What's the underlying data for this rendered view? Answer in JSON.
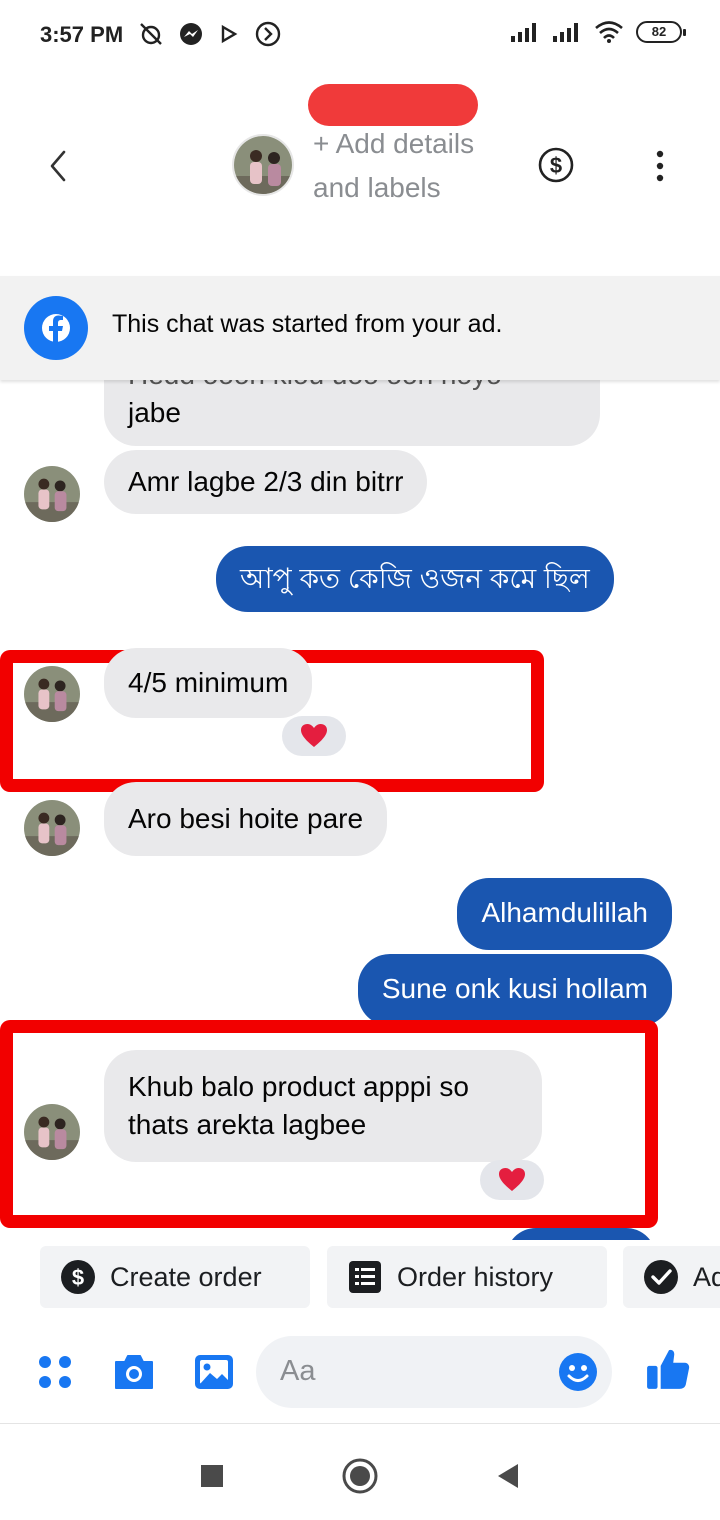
{
  "status_bar": {
    "time": "3:57 PM",
    "battery": "82"
  },
  "header": {
    "add_details": "+ Add details and labels"
  },
  "banner": {
    "text": "This chat was started from your ad."
  },
  "messages": [
    {
      "side": "in",
      "text_top": "Hedd oooh klou uoo ooh hoyo",
      "text": "jabe"
    },
    {
      "side": "in",
      "text": "Amr lagbe 2/3 din bitrr"
    },
    {
      "side": "out",
      "text": "আপু কত কেজি ওজন কমে ছিল"
    },
    {
      "side": "in",
      "text": "4/5 minimum",
      "reaction": "heart"
    },
    {
      "side": "in",
      "text": "Aro besi hoite pare"
    },
    {
      "side": "out",
      "text": "Alhamdulillah"
    },
    {
      "side": "out",
      "text": "Sune onk kusi hollam"
    },
    {
      "side": "in",
      "text_line1": "Khub balo product apppi so",
      "text_line2": "thats arekta lagbee",
      "reaction": "heart"
    }
  ],
  "quick_actions": {
    "create_order": "Create order",
    "order_history": "Order history",
    "third": "Ad"
  },
  "composer": {
    "placeholder": "Aa"
  },
  "colors": {
    "accent": "#1877f2",
    "outgoing_bubble": "#1a56b0",
    "incoming_bubble": "#e9e9eb",
    "highlight": "#f20000",
    "reaction_heart": "#e41e3f"
  },
  "icons": [
    "back-arrow-icon",
    "dollar-icon",
    "more-vertical-icon",
    "facebook-icon",
    "menu-dots-icon",
    "camera-icon",
    "gallery-icon",
    "emoji-icon",
    "thumbs-up-icon",
    "heart-icon",
    "check-icon",
    "order-history-icon"
  ]
}
